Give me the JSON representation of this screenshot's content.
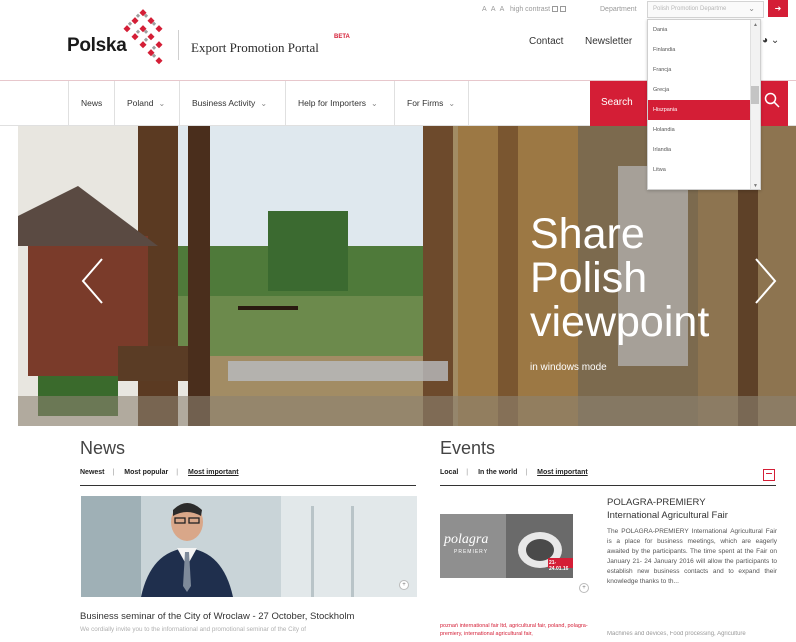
{
  "header": {
    "logo_text": "Polska",
    "portal_title": "Export Promotion Portal",
    "beta": "BETA",
    "font_size_controls": "A A A",
    "high_contrast": "high contrast",
    "department_label": "Department",
    "department_placeholder": "Polish Promotion Departme",
    "contact": "Contact",
    "newsletter": "Newsletter"
  },
  "dropdown": {
    "options": [
      "Dania",
      "Finlandia",
      "Francja",
      "Grecja",
      "Hiszpania",
      "Holandia",
      "Irlandia",
      "Litwa"
    ],
    "selected": "Hiszpania"
  },
  "nav": {
    "items": [
      "News",
      "Poland",
      "Business Activity",
      "Help for Importers",
      "For Firms"
    ],
    "search_label": "Search"
  },
  "hero": {
    "title_line1": "Share",
    "title_line2": "Polish",
    "title_line3": "viewpoint",
    "subtitle": "in windows mode"
  },
  "news": {
    "title": "News",
    "tabs": [
      "Newest",
      "Most popular",
      "Most important"
    ],
    "article_title": "Business seminar of the City of Wroclaw - 27 October, Stockholm",
    "article_snippet": "We cordially invite you to the informational and promotional seminar of the City of"
  },
  "events": {
    "title": "Events",
    "tabs": [
      "Local",
      "In the world",
      "Most important"
    ],
    "image_logo": "polagra",
    "image_logo_sub": "PREMIERY",
    "image_date": "21-24.01.16",
    "event_title_line1": "POLAGRA-PREMIERY",
    "event_title_line2": "International Agricultural Fair",
    "event_body": "The POLAGRA-PREMIERY International Agricultural Fair is a place for business meetings, which are eagerly awaited by the participants. The time spent at the Fair on January 21- 24 January 2016 will allow the participants to establish new business contacts and to expand their knowledge thanks to th...",
    "tags": "poznań international fair ltd, agricultural fair, poland, polagra-premiery, international agricultural fair,",
    "categories": "Machines and devices, Food processing, Agriculture"
  },
  "colors": {
    "accent": "#d41e36",
    "text": "#333333"
  },
  "icons": [
    "login-icon",
    "globe-icon",
    "search-icon",
    "chevron-left-icon",
    "chevron-right-icon",
    "calendar-icon",
    "plus-icon"
  ]
}
